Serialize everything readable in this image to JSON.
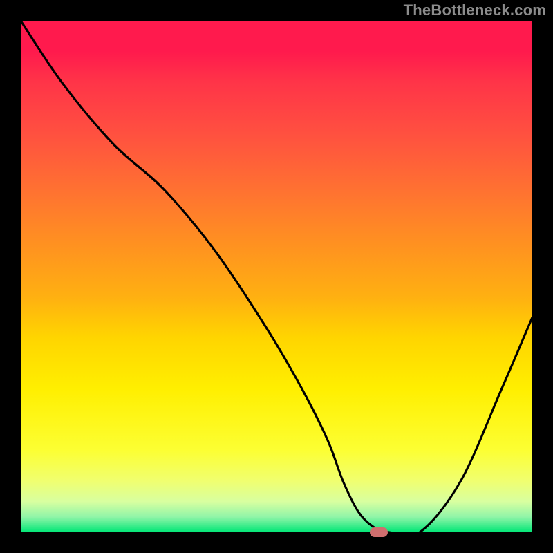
{
  "watermark": "TheBottleneck.com",
  "chart_data": {
    "type": "line",
    "title": "",
    "xlabel": "",
    "ylabel": "",
    "xlim": [
      0,
      100
    ],
    "ylim": [
      0,
      100
    ],
    "grid": false,
    "legend": false,
    "series": [
      {
        "name": "bottleneck-curve",
        "x": [
          0,
          8,
          18,
          28,
          38,
          48,
          55,
          60,
          63,
          66,
          69,
          72,
          78,
          86,
          94,
          100
        ],
        "y": [
          100,
          88,
          76,
          67,
          55,
          40,
          28,
          18,
          10,
          4,
          1,
          0,
          0,
          10,
          28,
          42
        ]
      }
    ],
    "marker": {
      "x": 70,
      "y": 0,
      "color": "#cf6e6e"
    },
    "background_gradient": {
      "top": "#ff1a4d",
      "bottom": "#00e676"
    }
  },
  "colors": {
    "frame": "#000000",
    "curve": "#000000",
    "watermark": "#8c8c8c"
  }
}
